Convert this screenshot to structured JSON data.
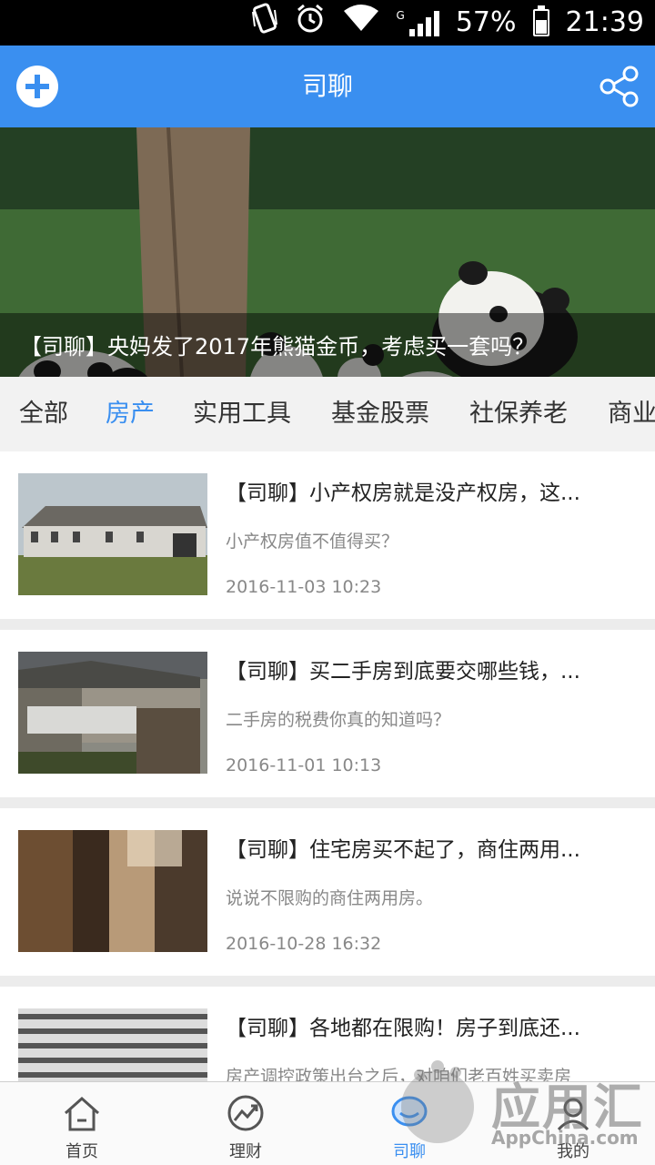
{
  "status_bar": {
    "battery": "57%",
    "time": "21:39",
    "network": "G",
    "icons": [
      "vibrate-icon",
      "alarm-icon",
      "wifi-icon",
      "signal-icon",
      "battery-icon"
    ]
  },
  "header": {
    "title": "司聊",
    "left_icon": "add-icon",
    "right_icon": "share-icon",
    "color": "#3a8ff0"
  },
  "banner": {
    "caption": "【司聊】央妈发了2017年熊猫金币，考虑买一套吗？"
  },
  "tabs": [
    {
      "label": "全部",
      "active": false
    },
    {
      "label": "房产",
      "active": true
    },
    {
      "label": "实用工具",
      "active": false
    },
    {
      "label": "基金股票",
      "active": false
    },
    {
      "label": "社保养老",
      "active": false
    },
    {
      "label": "商业",
      "active": false
    }
  ],
  "articles": [
    {
      "title": "【司聊】小产权房就是没产权房，这...",
      "desc": "小产权房值不值得买？",
      "date": "2016-11-03 10:23"
    },
    {
      "title": "【司聊】买二手房到底要交哪些钱，...",
      "desc": "二手房的税费你真的知道吗？",
      "date": "2016-11-01 10:13"
    },
    {
      "title": "【司聊】住宅房买不起了，商住两用...",
      "desc": "说说不限购的商住两用房。",
      "date": "2016-10-28 16:32"
    },
    {
      "title": "【司聊】各地都在限购！房子到底还...",
      "desc": "房产调控政策出台之后，对咱们老百姓买卖房",
      "date": ""
    }
  ],
  "bottom_nav": [
    {
      "label": "首页",
      "icon": "home-icon",
      "active": false
    },
    {
      "label": "理财",
      "icon": "finance-icon",
      "active": false
    },
    {
      "label": "司聊",
      "icon": "chat-icon",
      "active": true
    },
    {
      "label": "我的",
      "icon": "profile-icon",
      "active": false
    }
  ],
  "watermark": {
    "text": "应用汇",
    "sub": "AppChina.com"
  }
}
